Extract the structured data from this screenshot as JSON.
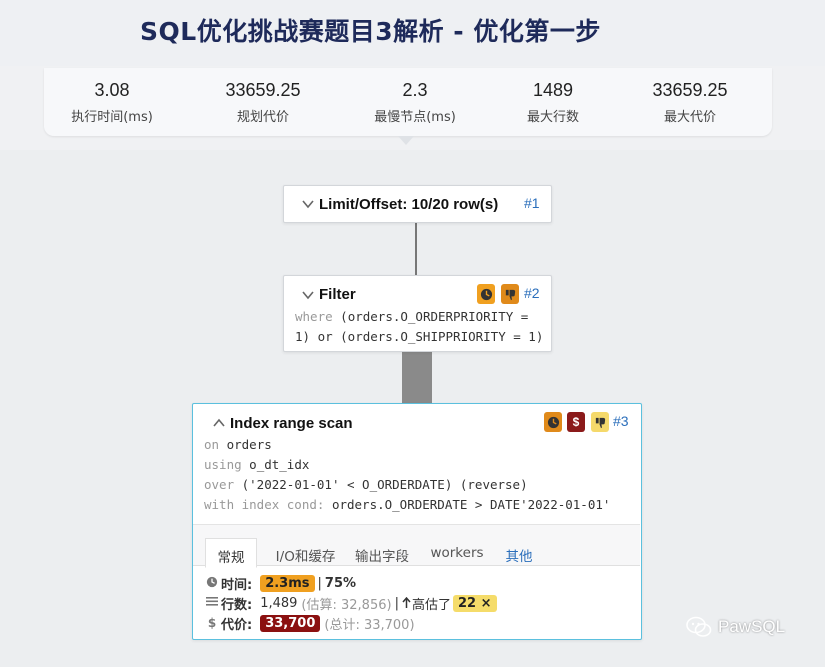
{
  "page": {
    "title": "SQL优化挑战赛题目3解析 - 优化第一步"
  },
  "stats": [
    {
      "value": "3.08",
      "label": "执行时间(ms)"
    },
    {
      "value": "33659.25",
      "label": "规划代价"
    },
    {
      "value": "2.3",
      "label": "最慢节点(ms)"
    },
    {
      "value": "1489",
      "label": "最大行数"
    },
    {
      "value": "33659.25",
      "label": "最大代价"
    }
  ],
  "nodes": {
    "limit": {
      "title": "Limit/Offset: 10/20 row(s)",
      "id": "#1"
    },
    "filter": {
      "title": "Filter",
      "id": "#2",
      "kw_where": "where",
      "line1": " (orders.O_ORDERPRIORITY =",
      "line2": "1) or (orders.O_SHIPPRIORITY = 1)"
    },
    "scan": {
      "title": "Index range scan",
      "id": "#3",
      "kw_on": "on",
      "on_val": " orders",
      "kw_using": "using",
      "using_val": " o_dt_idx",
      "kw_over": "over",
      "over_val": " ('2022-01-01' < O_ORDERDATE) (reverse)",
      "kw_cond": "with index cond:",
      "cond_val": " orders.O_ORDERDATE > DATE'2022-01-01'",
      "badge_cost": "$",
      "tabs": [
        "常规",
        "I/O和缓存",
        "输出字段",
        "workers",
        "其他"
      ],
      "metrics": {
        "time_label": "时间:",
        "time_value": "2.3ms",
        "time_sep": "|",
        "time_pct": "75%",
        "rows_label": "行数:",
        "rows_value": "1,489",
        "rows_est": "(估算: 32,856)",
        "rows_sep": "|",
        "rows_over": "高估了",
        "rows_factor": "22 ×",
        "cost_label": "代价:",
        "cost_value": "33,700",
        "cost_total": "(总计: 33,700)"
      }
    }
  },
  "icons": {
    "clock": "clock-icon",
    "thumbs_down": "thumbs-down-icon",
    "dollar": "dollar-icon",
    "chevron_down": "chevron-down-icon",
    "chevron_up": "chevron-up-icon",
    "rows": "rows-icon",
    "arrow_up": "arrow-up-icon",
    "wechat": "wechat-icon"
  },
  "watermark": {
    "text": "PawSQL"
  },
  "colors": {
    "accent": "#2a6ebb",
    "title": "#1e2a5a",
    "selected_border": "#5bc0de",
    "cost_badge": "#8b1a1a",
    "time_badge": "#f0a020"
  }
}
